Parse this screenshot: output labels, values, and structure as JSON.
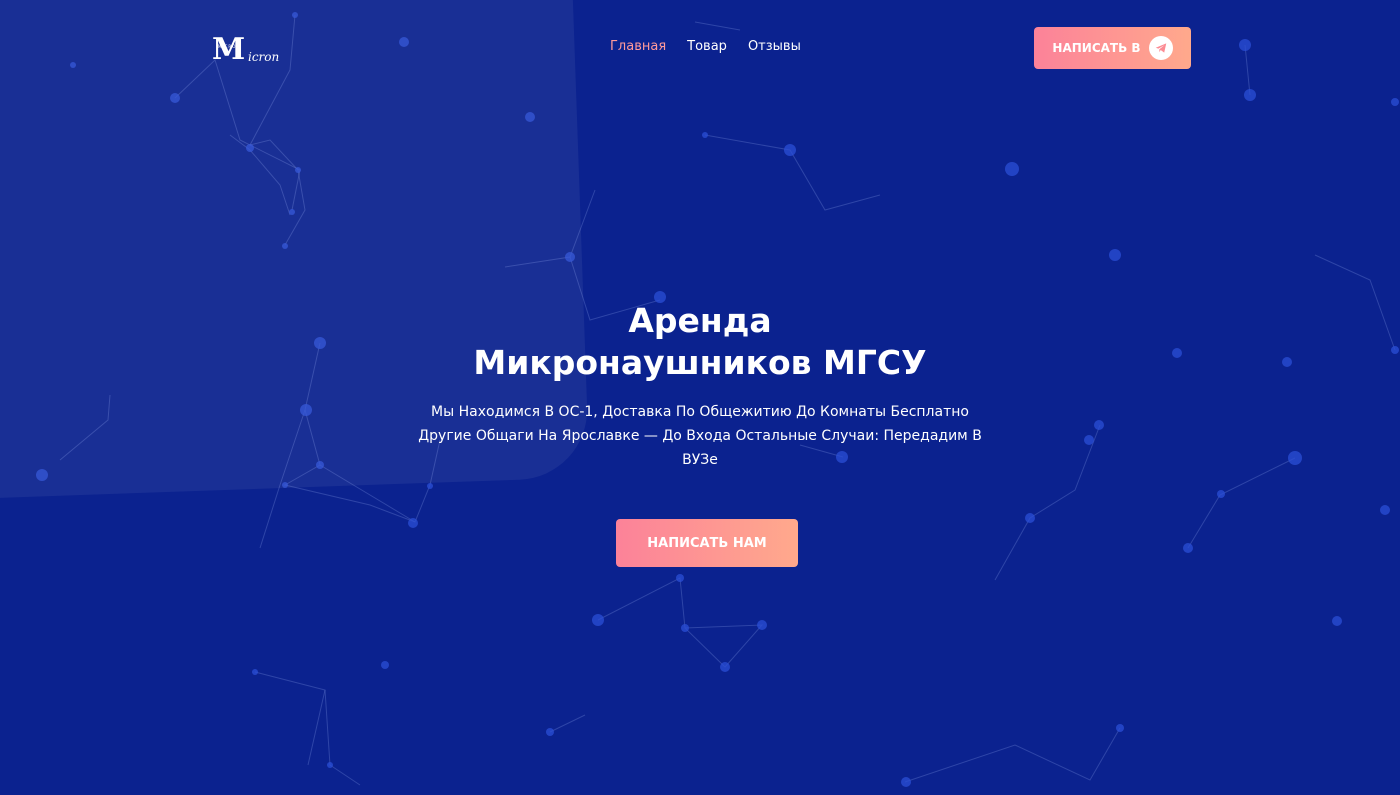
{
  "logo": {
    "initial": "M",
    "small_text": "MICRON",
    "rest": "icron"
  },
  "nav": {
    "items": [
      {
        "label": "Главная",
        "active": true
      },
      {
        "label": "Товар",
        "active": false
      },
      {
        "label": "Отзывы",
        "active": false
      }
    ]
  },
  "header_button": {
    "label": "НАПИСАТЬ В",
    "icon": "telegram-icon"
  },
  "hero": {
    "title_line1": "Аренда",
    "title_line2": "Микронаушников МГСУ",
    "desc_line1": "Мы Находимся В ОС-1, Доставка По Общежитию До Комнаты Бесплатно",
    "desc_line2": "Другие Общаги На Ярославке — До Входа Остальные Случаи: Передадим В",
    "desc_line3": "ВУЗе",
    "button_label": "НАПИСАТЬ НАМ"
  },
  "colors": {
    "background": "#0b228f",
    "accent_start": "#fc8299",
    "accent_end": "#ffa98c",
    "nav_active": "#ff9a9a",
    "network_line": "#6f86d8",
    "network_dot": "#2b4fd6"
  }
}
